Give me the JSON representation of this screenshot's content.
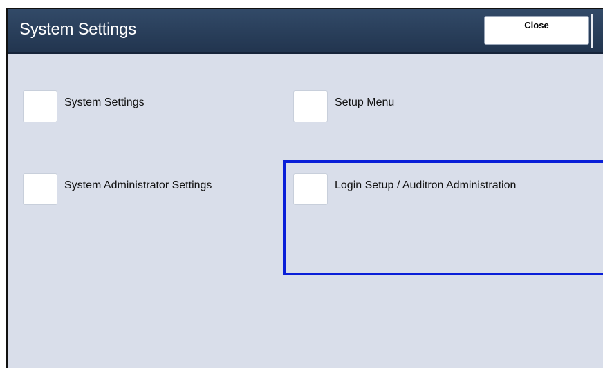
{
  "header": {
    "title": "System Settings",
    "close_label": "Close"
  },
  "options": [
    {
      "label": "System Settings"
    },
    {
      "label": "Setup Menu"
    },
    {
      "label": "System Administrator Settings"
    },
    {
      "label": "Login Setup / Auditron Administration"
    }
  ],
  "colors": {
    "titlebar": "#2b3f5c",
    "background": "#d9deea",
    "highlight": "#0a1fd8"
  }
}
